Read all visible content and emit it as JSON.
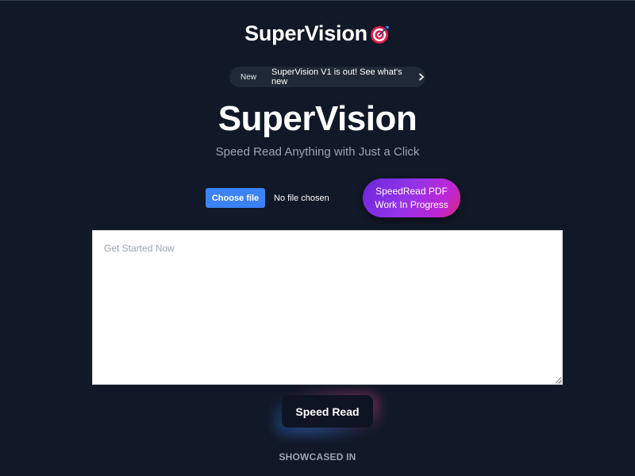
{
  "header": {
    "brand": "SuperVision",
    "brand_icon": "direct-hit-target-icon"
  },
  "announcement": {
    "badge": "New",
    "text": "SuperVision V1 is out! See what's new",
    "icon": "chevron-right-icon"
  },
  "hero": {
    "title": "SuperVision",
    "subtitle": "Speed Read Anything with Just a Click"
  },
  "file_upload": {
    "button_label": "Choose file",
    "status": "No file chosen"
  },
  "pdf_button": {
    "line1": "SpeedRead PDF",
    "line2": "Work In Progress"
  },
  "text_input": {
    "placeholder": "Get Started Now",
    "value": ""
  },
  "speed_read_button": {
    "label": "Speed Read"
  },
  "footer": {
    "showcased_label": "SHOWCASED IN"
  },
  "colors": {
    "background": "#111827",
    "accent_blue": "#3b82f6",
    "gradient_start": "#6d28d9",
    "gradient_end": "#db2777",
    "muted_text": "#9ca3af"
  }
}
